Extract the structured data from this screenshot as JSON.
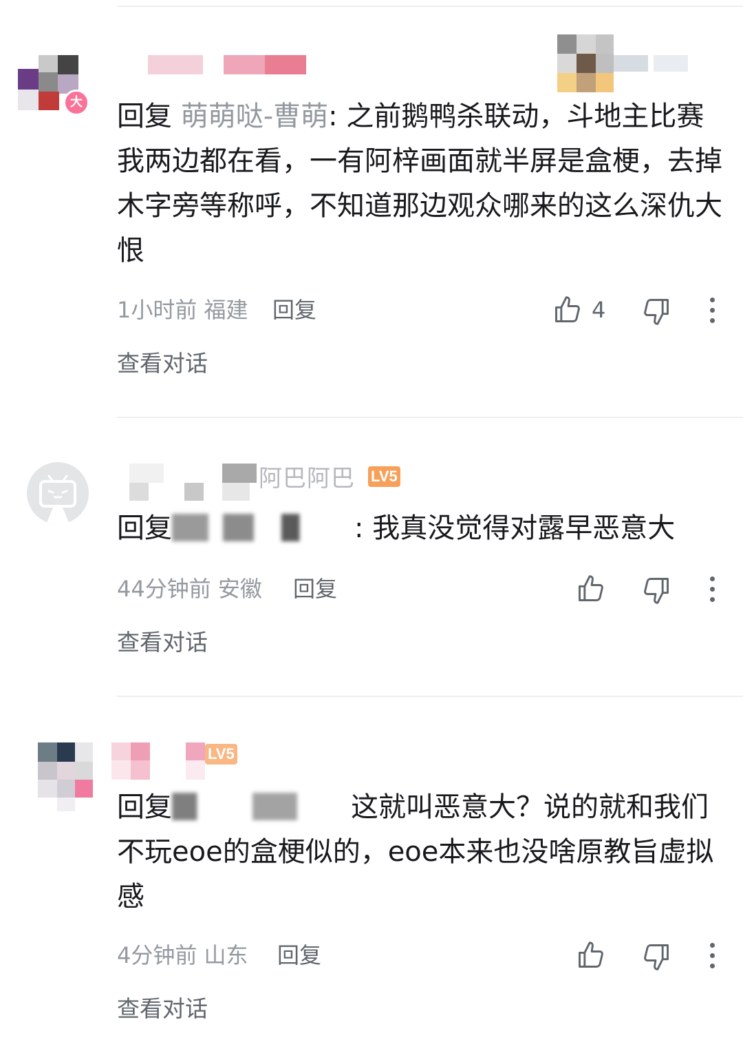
{
  "comments": [
    {
      "reply_prefix": "回复 ",
      "target": "萌萌哒-曹萌",
      "content": ": 之前鹅鸭杀联动，斗地主比赛我两边都在看，一有阿梓画面就半屏是盒梗，去掉木字旁等称呼，不知道那边观众哪来的这么深仇大恨",
      "time": "1小时前",
      "location": "福建",
      "reply_label": "回复",
      "like_count": "4",
      "view_conversation": "查看对话",
      "avatar_badge": "大"
    },
    {
      "name_visible": "阿巴阿巴",
      "level": "LV5",
      "reply_prefix": "回复",
      "content": ": 我真没觉得对露早恶意大",
      "time": "44分钟前",
      "location": "安徽",
      "reply_label": "回复",
      "view_conversation": "查看对话"
    },
    {
      "level": "LV5",
      "reply_prefix": "回复",
      "content": "这就叫恶意大？说的就和我们不玩eoe的盒梗似的，eoe本来也没啥原教旨虚拟感",
      "time": "4分钟前",
      "location": "山东",
      "reply_label": "回复",
      "view_conversation": "查看对话"
    }
  ],
  "colors": {
    "primary_text": "#18191c",
    "secondary_text": "#9499a0",
    "action_text": "#61666d",
    "level_badge": "#f6a05a",
    "divider": "#eeeeee"
  }
}
